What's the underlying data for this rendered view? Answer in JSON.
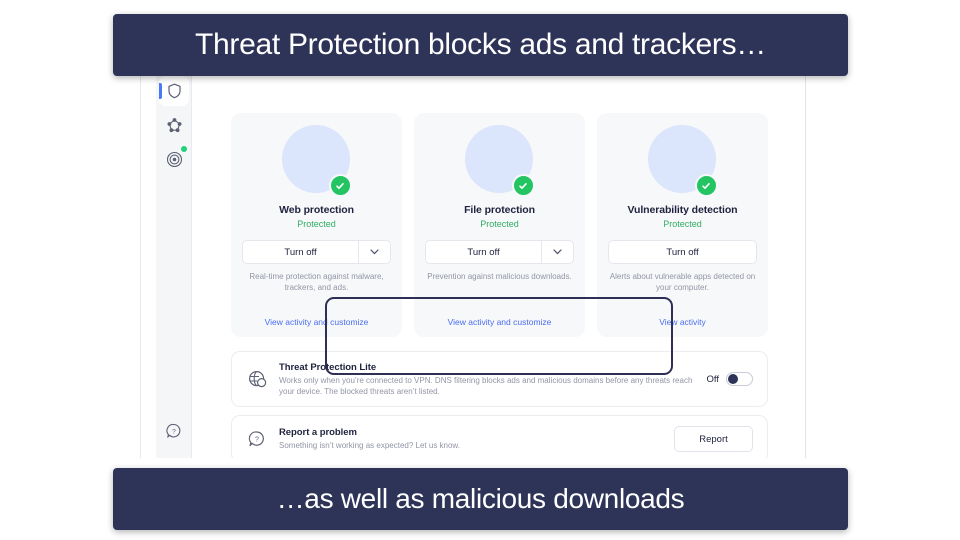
{
  "captions": {
    "top": "Threat Protection blocks ads and trackers…",
    "bottom": "…as well as malicious downloads"
  },
  "sidebar": {
    "items": [
      {
        "icon": "shield-icon",
        "active": true,
        "badge": false
      },
      {
        "icon": "mesh-network-icon",
        "active": false,
        "badge": false
      },
      {
        "icon": "radar-target-icon",
        "active": false,
        "badge": true
      }
    ],
    "bottom_item": {
      "icon": "help-circle-icon"
    }
  },
  "cards": [
    {
      "icon": "monitor-broom-icon",
      "title": "Web protection",
      "status": "Protected",
      "action_label": "Turn off",
      "has_dropdown": true,
      "description": "Real-time protection against malware, trackers, and ads.",
      "link": "View activity and customize"
    },
    {
      "icon": "folder-virus-icon",
      "title": "File protection",
      "status": "Protected",
      "action_label": "Turn off",
      "has_dropdown": true,
      "description": "Prevention against malicious downloads.",
      "link": "View activity and customize"
    },
    {
      "icon": "monitor-bug-icon",
      "title": "Vulnerability detection",
      "status": "Protected",
      "action_label": "Turn off",
      "has_dropdown": false,
      "description": "Alerts about vulnerable apps detected on your computer.",
      "link": "View activity"
    }
  ],
  "lite_row": {
    "icon": "globe-shield-icon",
    "title": "Threat Protection Lite",
    "description": "Works only when you’re connected to VPN. DNS filtering blocks ads and malicious domains before any threats reach your device. The blocked threats aren’t listed.",
    "toggle_label": "Off",
    "toggle_state": "off"
  },
  "report_row": {
    "icon": "question-chat-icon",
    "title": "Report a problem",
    "description": "Something isn’t working as expected? Let us know.",
    "button_label": "Report"
  },
  "colors": {
    "caption_bg": "#2e3458",
    "accent_blue": "#4a6df0",
    "success_green": "#23c462",
    "status_green": "#2fae63",
    "card_bg": "#f7f8fa",
    "highlight_border": "#2e2f54"
  }
}
